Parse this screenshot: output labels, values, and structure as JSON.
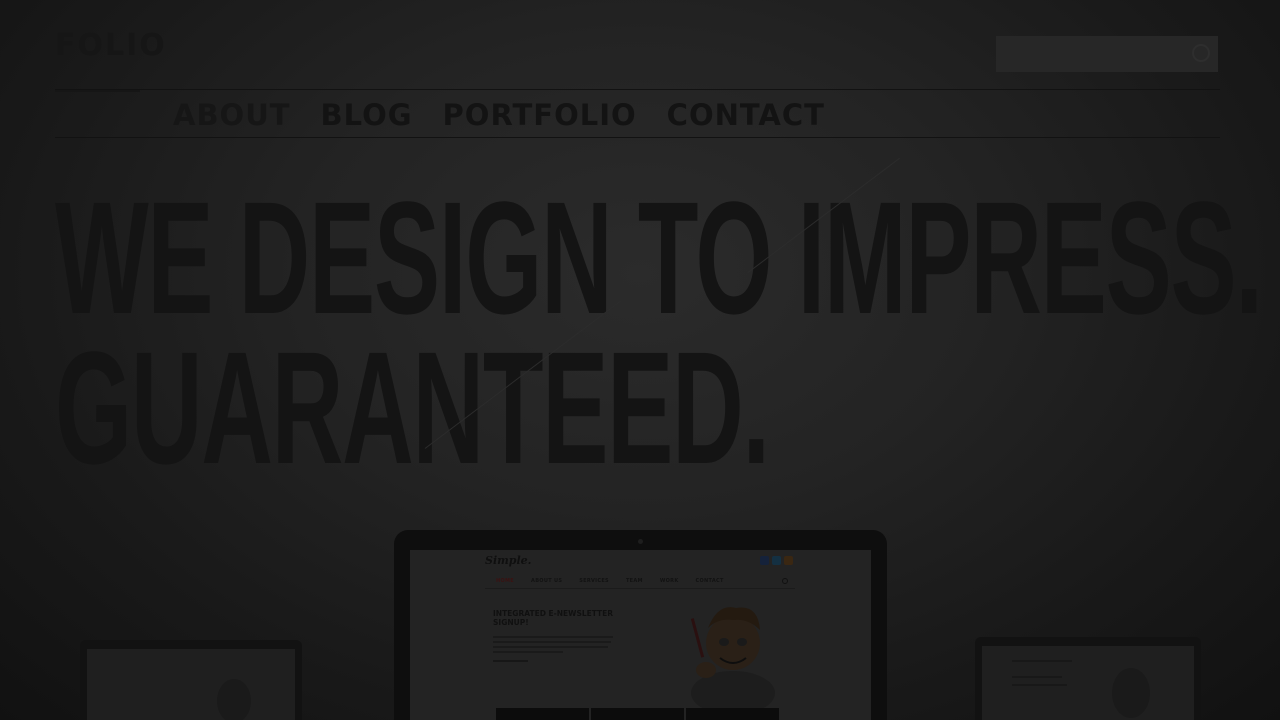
{
  "brand": {
    "logo_text": "FOLIO"
  },
  "search": {
    "placeholder": ""
  },
  "nav": {
    "items": [
      {
        "label": "ABOUT"
      },
      {
        "label": "BLOG"
      },
      {
        "label": "PORTFOLIO"
      },
      {
        "label": "CONTACT"
      }
    ]
  },
  "hero": {
    "line1": "WE DESIGN TO IMPRESS.",
    "line2": "GUARANTEED."
  },
  "showcase": {
    "mini_site": {
      "logo": "Simple.",
      "nav": [
        "HOME",
        "ABOUT US",
        "SERVICES",
        "TEAM",
        "WORK",
        "CONTACT"
      ],
      "heading": "INTEGRATED E-NEWSLETTER SIGNUP!",
      "tiles": [
        "",
        "",
        ""
      ]
    }
  },
  "colors": {
    "overlay": "#1c1c1c",
    "text_dark": "#141414",
    "social_facebook": "#15223a",
    "social_twitter": "#143042",
    "social_rss": "#3a2712"
  }
}
